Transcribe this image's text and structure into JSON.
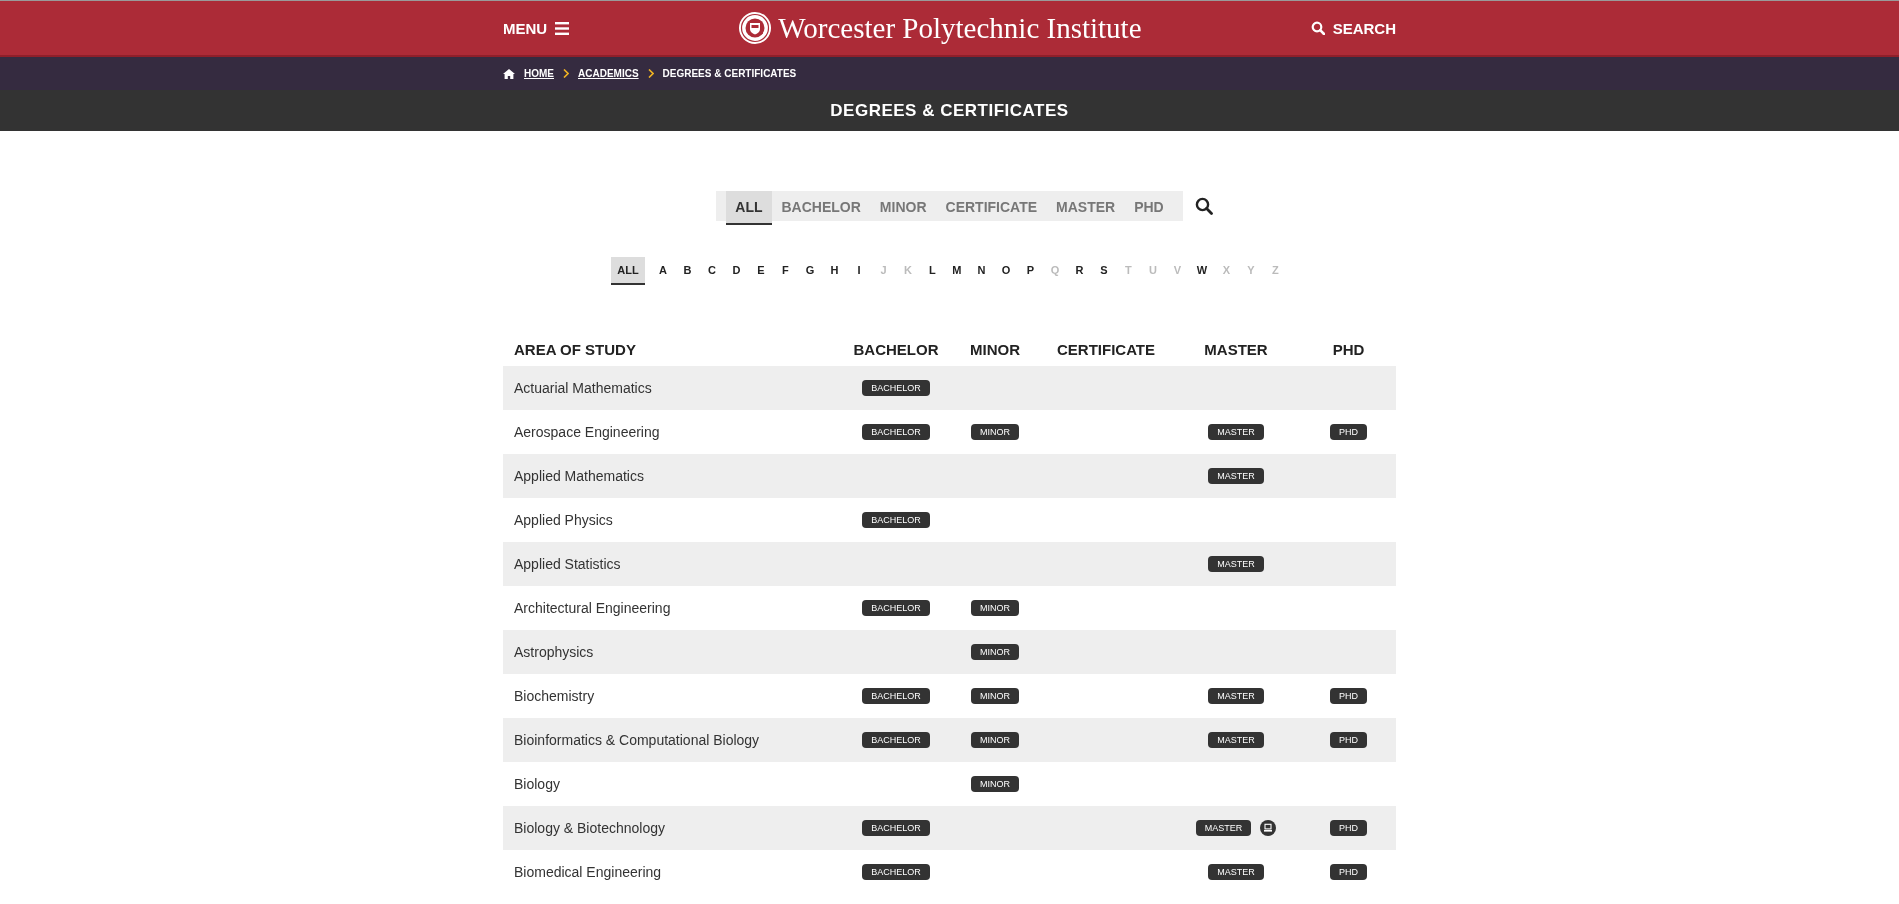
{
  "header": {
    "menu": "MENU",
    "site_title": "Worcester Polytechnic Institute",
    "search": "SEARCH"
  },
  "breadcrumb": [
    {
      "label": "HOME",
      "link": true
    },
    {
      "label": "ACADEMICS",
      "link": true
    },
    {
      "label": "DEGREES & CERTIFICATES",
      "link": false
    }
  ],
  "page_title": "DEGREES & CERTIFICATES",
  "type_tabs": [
    {
      "label": "ALL",
      "selected": true
    },
    {
      "label": "BACHELOR",
      "selected": false
    },
    {
      "label": "MINOR",
      "selected": false
    },
    {
      "label": "CERTIFICATE",
      "selected": false
    },
    {
      "label": "MASTER",
      "selected": false
    },
    {
      "label": "PHD",
      "selected": false
    }
  ],
  "letters": [
    {
      "label": "ALL",
      "selected": true,
      "disabled": false
    },
    {
      "label": "A",
      "selected": false,
      "disabled": false
    },
    {
      "label": "B",
      "selected": false,
      "disabled": false
    },
    {
      "label": "C",
      "selected": false,
      "disabled": false
    },
    {
      "label": "D",
      "selected": false,
      "disabled": false
    },
    {
      "label": "E",
      "selected": false,
      "disabled": false
    },
    {
      "label": "F",
      "selected": false,
      "disabled": false
    },
    {
      "label": "G",
      "selected": false,
      "disabled": false
    },
    {
      "label": "H",
      "selected": false,
      "disabled": false
    },
    {
      "label": "I",
      "selected": false,
      "disabled": false
    },
    {
      "label": "J",
      "selected": false,
      "disabled": true
    },
    {
      "label": "K",
      "selected": false,
      "disabled": true
    },
    {
      "label": "L",
      "selected": false,
      "disabled": false
    },
    {
      "label": "M",
      "selected": false,
      "disabled": false
    },
    {
      "label": "N",
      "selected": false,
      "disabled": false
    },
    {
      "label": "O",
      "selected": false,
      "disabled": false
    },
    {
      "label": "P",
      "selected": false,
      "disabled": false
    },
    {
      "label": "Q",
      "selected": false,
      "disabled": true
    },
    {
      "label": "R",
      "selected": false,
      "disabled": false
    },
    {
      "label": "S",
      "selected": false,
      "disabled": false
    },
    {
      "label": "T",
      "selected": false,
      "disabled": true
    },
    {
      "label": "U",
      "selected": false,
      "disabled": true
    },
    {
      "label": "V",
      "selected": false,
      "disabled": true
    },
    {
      "label": "W",
      "selected": false,
      "disabled": false
    },
    {
      "label": "X",
      "selected": false,
      "disabled": true
    },
    {
      "label": "Y",
      "selected": false,
      "disabled": true
    },
    {
      "label": "Z",
      "selected": false,
      "disabled": true
    }
  ],
  "table": {
    "columns": [
      "AREA OF STUDY",
      "BACHELOR",
      "MINOR",
      "CERTIFICATE",
      "MASTER",
      "PHD"
    ],
    "rows": [
      {
        "cells": [
          "Actuarial Mathematics",
          "BACHELOR",
          "",
          "",
          "",
          ""
        ]
      },
      {
        "cells": [
          "Aerospace Engineering",
          "BACHELOR",
          "MINOR",
          "",
          "MASTER",
          "PHD"
        ]
      },
      {
        "cells": [
          "Applied Mathematics",
          "",
          "",
          "",
          "MASTER",
          ""
        ]
      },
      {
        "cells": [
          "Applied Physics",
          "BACHELOR",
          "",
          "",
          "",
          ""
        ]
      },
      {
        "cells": [
          "Applied Statistics",
          "",
          "",
          "",
          "MASTER",
          ""
        ]
      },
      {
        "cells": [
          "Architectural Engineering",
          "BACHELOR",
          "MINOR",
          "",
          "",
          ""
        ]
      },
      {
        "cells": [
          "Astrophysics",
          "",
          "MINOR",
          "",
          "",
          ""
        ]
      },
      {
        "cells": [
          "Biochemistry",
          "BACHELOR",
          "MINOR",
          "",
          "MASTER",
          "PHD"
        ]
      },
      {
        "cells": [
          "Bioinformatics & Computational Biology",
          "BACHELOR",
          "MINOR",
          "",
          "MASTER",
          "PHD"
        ]
      },
      {
        "cells": [
          "Biology",
          "",
          "MINOR",
          "",
          "",
          ""
        ]
      },
      {
        "cells": [
          "Biology & Biotechnology",
          "BACHELOR",
          "",
          "",
          {
            "label": "MASTER",
            "online": true
          },
          "PHD"
        ]
      },
      {
        "cells": [
          "Biomedical Engineering",
          "BACHELOR",
          "",
          "",
          "MASTER",
          "PHD"
        ]
      }
    ]
  }
}
